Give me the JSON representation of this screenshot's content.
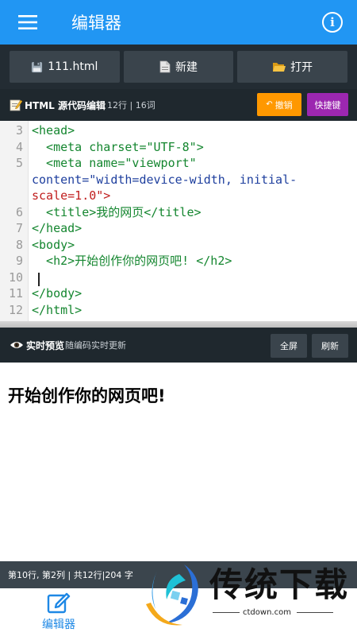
{
  "appbar": {
    "title": "编辑器"
  },
  "toolbar": {
    "file_label": "111.html",
    "new_label": "新建",
    "open_label": "打开"
  },
  "source_header": {
    "title": "HTML 源代码编辑",
    "stats": "12行 | 16词",
    "undo_label": "撤销",
    "shortcut_label": "快捷键"
  },
  "editor": {
    "lines": [
      {
        "num": "3",
        "text": "<head>"
      },
      {
        "num": "4",
        "text": "  <meta charset=\"UTF-8\">"
      },
      {
        "num": "5",
        "text": "  <meta name=\"viewport\""
      },
      {
        "num": "",
        "text": "content=\"width=device-width, initial-"
      },
      {
        "num": "",
        "text": "scale=1.0\">"
      },
      {
        "num": "6",
        "text": "  <title>我的网页</title>"
      },
      {
        "num": "7",
        "text": "</head>"
      },
      {
        "num": "8",
        "text": "<body>"
      },
      {
        "num": "9",
        "text": "  <h2>开始创作你的网页吧! </h2>"
      },
      {
        "num": "10",
        "text": ""
      },
      {
        "num": "11",
        "text": "</body>"
      },
      {
        "num": "12",
        "text": "</html>"
      }
    ]
  },
  "preview_header": {
    "title": "实时预览",
    "subtitle": "随编码实时更新",
    "fullscreen_label": "全屏",
    "refresh_label": "刷新"
  },
  "preview": {
    "heading": "开始创作你的网页吧!"
  },
  "statusbar": {
    "text": "第10行, 第2列 | 共12行|204 字"
  },
  "bottomnav": {
    "editor_label": "编辑器"
  },
  "watermark": {
    "brand": "传统下载",
    "url": "ctdown.com"
  },
  "colors": {
    "primary": "#2196f3",
    "dark_bar": "#232c33",
    "undo": "#ff9800",
    "shortcut": "#9c27b0",
    "tag": "#14862f",
    "attr": "#1e3f9e",
    "string": "#c01d1d"
  },
  "icons": [
    "menu-icon",
    "info-icon",
    "save-icon",
    "new-file-icon",
    "folder-icon",
    "memo-icon",
    "undo-icon",
    "eye-icon",
    "edit-icon"
  ]
}
